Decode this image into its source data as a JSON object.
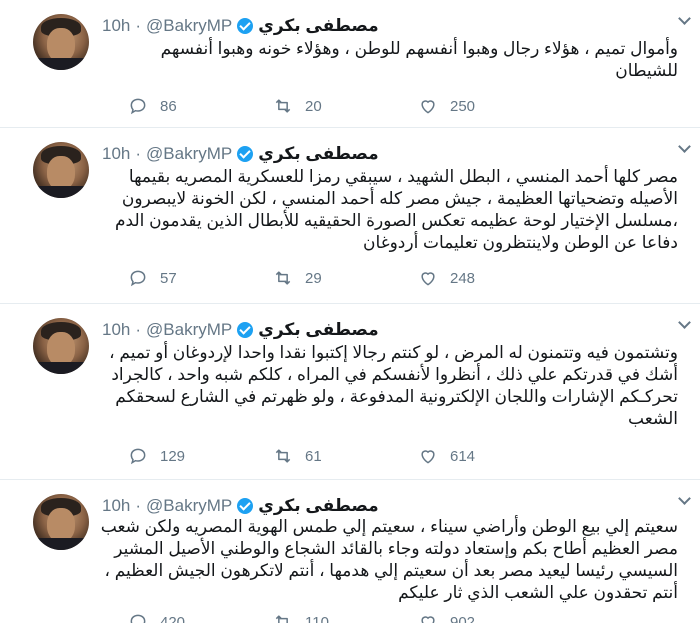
{
  "tweets": [
    {
      "name": "مصطفى بكري",
      "handle": "@BakryMP",
      "dot": "·",
      "time": "10h",
      "lines": [
        "وأموال تميم ، هؤلاء رجال وهبوا أنفسهم للوطن ، وهؤلاء خونه وهبوا أنفسهم",
        "للشيطان"
      ],
      "replies": "86",
      "retweets": "20",
      "likes": "250"
    },
    {
      "name": "مصطفى بكري",
      "handle": "@BakryMP",
      "dot": "·",
      "time": "10h",
      "lines": [
        "مصر كلها أحمد المنسي ، البطل الشهيد ، سيبقي رمزا للعسكرية المصريه بقيمها",
        "الأصيله وتضحياتها العظيمة ، جيش مصر كله أحمد المنسي ، لكن الخونة لايبصرون",
        "،مسلسل الإختيار لوحة عظيمه تعكس الصورة الحقيقيه للأبطال الذين يقدمون الدم",
        "دفاعا عن الوطن ولاينتظرون تعليمات أردوغان"
      ],
      "replies": "57",
      "retweets": "29",
      "likes": "248"
    },
    {
      "name": "مصطفى بكري",
      "handle": "@BakryMP",
      "dot": "·",
      "time": "10h",
      "lines": [
        "وتشتمون فيه وتتمنون له المرض ، لو كنتم رجالا إكتبوا نقدا واحدا لإردوغان أو تميم ،",
        "أشك في قدرتكم علي ذلك ، أنظروا لأنفسكم في المراه ، كلكم شبه واحد ، كالجراد",
        "تحركـكم الإشارات واللجان الإلكترونية المدفوعة ، ولو ظهرتم في الشارع لسحقكم",
        "الشعب"
      ],
      "replies": "129",
      "retweets": "61",
      "likes": "614"
    },
    {
      "name": "مصطفى بكري",
      "handle": "@BakryMP",
      "dot": "·",
      "time": "10h",
      "lines": [
        "سعيتم إلي بيع الوطن وأراضي سيناء ، سعيتم إلي طمس الهوية المصريه ولكن شعب",
        "مصر العظيم أطاح بكم وإستعاد دولته وجاء بالقائد الشجاع والوطني الأصيل المشير",
        "السيسي رئيسا ليعيد مصر بعد أن سعيتم إلي هدمها ، أنتم لاتكرهون الجيش العظيم ،",
        "أنتم تحقدون علي الشعب الذي ثار عليكم"
      ],
      "replies": "420",
      "retweets": "110",
      "likes": "902"
    }
  ],
  "colors": {
    "text": "#14171a",
    "muted": "#657786",
    "verified": "#1da1f2",
    "divider": "#e6ecf0"
  },
  "icons": [
    "reply-icon",
    "retweet-icon",
    "like-icon",
    "verified-badge-icon",
    "chevron-down-icon"
  ]
}
